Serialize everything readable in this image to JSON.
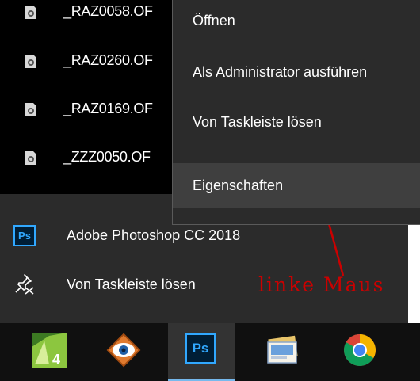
{
  "recent_files": [
    {
      "label": "_RAZ0058.OF",
      "icon": "raw-file-icon"
    },
    {
      "label": "_RAZ0260.OF",
      "icon": "raw-file-icon"
    },
    {
      "label": "_RAZ0169.OF",
      "icon": "raw-file-icon"
    },
    {
      "label": "_ZZZ0050.OF",
      "icon": "raw-file-icon"
    }
  ],
  "tasks": {
    "app_label": "Adobe Photoshop CC 2018",
    "app_icon_text": "Ps",
    "unpin_label": "Von Taskleiste lösen"
  },
  "context_menu": {
    "open": "Öffnen",
    "run_as_admin": "Als Administrator ausführen",
    "unpin": "Von Taskleiste lösen",
    "properties": "Eigenschaften"
  },
  "annotation": {
    "text": "linke Maus",
    "color": "#cc0000"
  },
  "taskbar": {
    "ps_icon_text": "Ps",
    "icons": [
      "faststone-icon",
      "eye-app-icon",
      "photoshop-icon",
      "mail-icon",
      "chrome-icon"
    ]
  },
  "colors": {
    "panel": "#2b2b2b",
    "recent_bg": "#000000",
    "highlight": "#3f3f3f",
    "accent": "#31a8ff"
  }
}
